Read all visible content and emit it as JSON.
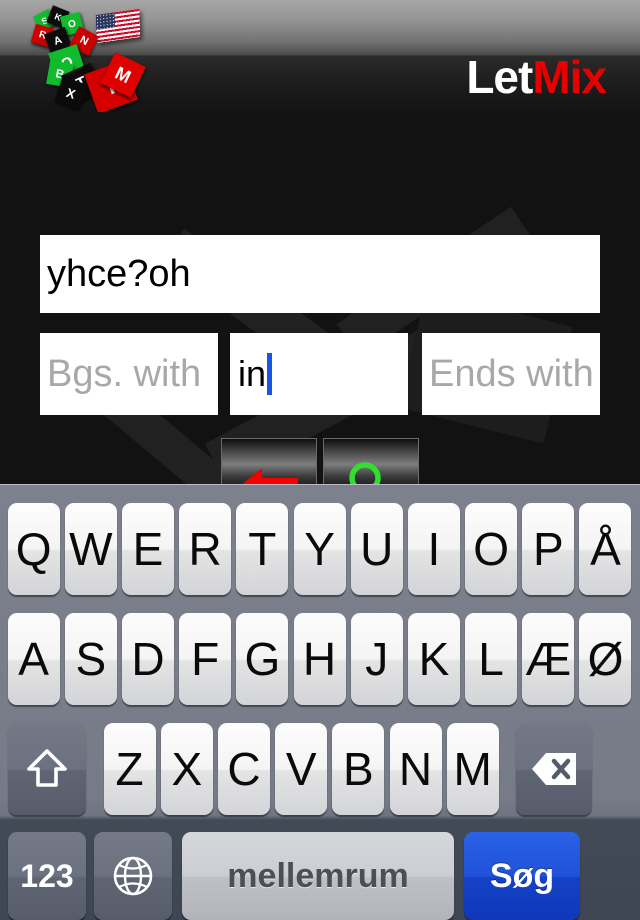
{
  "header": {
    "brand_primary": "Let",
    "brand_accent": "Mix",
    "brand_primary_color": "#ffffff",
    "brand_accent_color": "#e60000",
    "logo_icon": "dice-letters-logo",
    "flag_icon": "us-flag-icon",
    "dice_letters": [
      "S",
      "K",
      "O",
      "R",
      "A",
      "N",
      "O",
      "B",
      "T",
      "X",
      "I",
      "M"
    ]
  },
  "fields": {
    "word": {
      "value": "yhce?oh",
      "placeholder": ""
    },
    "begins_with": {
      "value": "",
      "placeholder": "Bgs. with"
    },
    "contains": {
      "value": "in",
      "placeholder": "",
      "caret": true,
      "caret_color": "#1956e8"
    },
    "ends_with": {
      "value": "",
      "placeholder": "Ends with"
    }
  },
  "actions": {
    "back": {
      "icon": "left-arrow-icon",
      "color": "#f40000"
    },
    "search": {
      "icon": "magnifier-icon",
      "color": "#2fe02f"
    }
  },
  "keyboard": {
    "language": "Danish",
    "row1": [
      "Q",
      "W",
      "E",
      "R",
      "T",
      "Y",
      "U",
      "I",
      "O",
      "P",
      "Å"
    ],
    "row2": [
      "A",
      "S",
      "D",
      "F",
      "G",
      "H",
      "J",
      "K",
      "L",
      "Æ",
      "Ø"
    ],
    "row3": [
      "Z",
      "X",
      "C",
      "V",
      "B",
      "N",
      "M"
    ],
    "shift": {
      "icon": "shift-arrow-icon",
      "label": ""
    },
    "backspace": {
      "icon": "backspace-delete-icon",
      "label": ""
    },
    "numeric": {
      "label": "123"
    },
    "globe": {
      "icon": "globe-icon",
      "label": ""
    },
    "space": {
      "label": "mellemrum"
    },
    "return": {
      "label": "Søg"
    }
  }
}
